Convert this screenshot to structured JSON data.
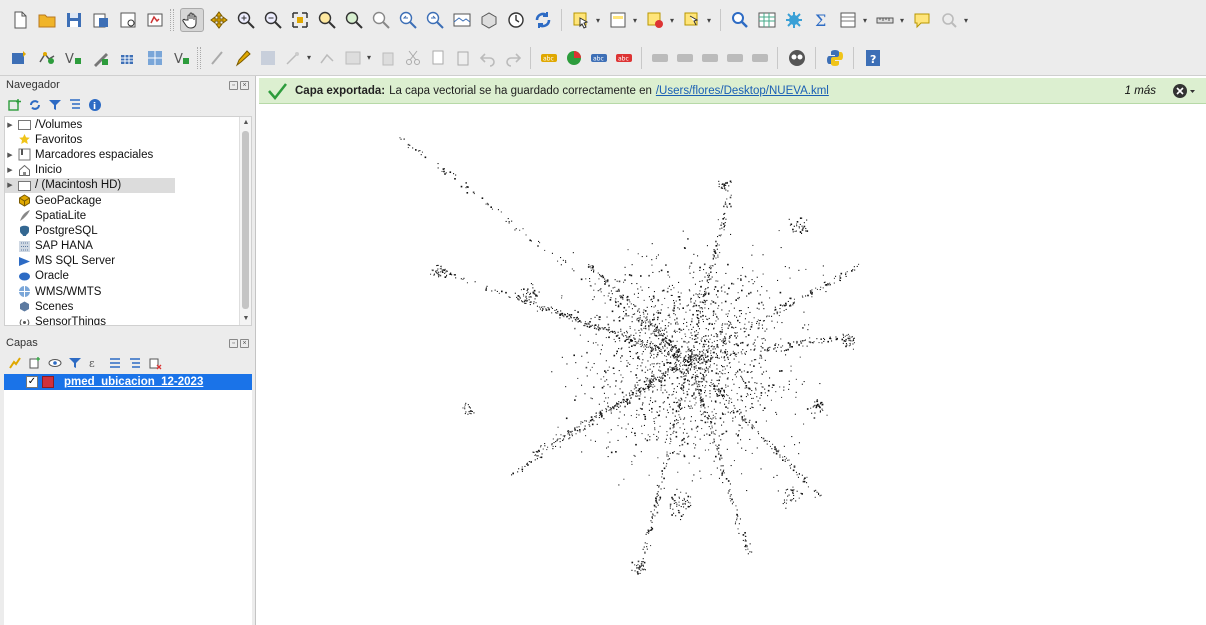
{
  "navigator": {
    "title": "Navegador",
    "items": [
      {
        "label": "/Volumes",
        "icon": "folder-icon",
        "expandable": true
      },
      {
        "label": "Favoritos",
        "icon": "star-icon",
        "expandable": false
      },
      {
        "label": "Marcadores espaciales",
        "icon": "bookmarks-icon",
        "expandable": true
      },
      {
        "label": "Inicio",
        "icon": "home-icon",
        "expandable": true
      },
      {
        "label": "/ (Macintosh HD)",
        "icon": "folder-icon",
        "expandable": true,
        "selected": true
      },
      {
        "label": "GeoPackage",
        "icon": "geopackage-icon",
        "expandable": false
      },
      {
        "label": "SpatiaLite",
        "icon": "spatialite-icon",
        "expandable": false
      },
      {
        "label": "PostgreSQL",
        "icon": "postgresql-icon",
        "expandable": false
      },
      {
        "label": "SAP HANA",
        "icon": "sap-hana-icon",
        "expandable": false
      },
      {
        "label": "MS SQL Server",
        "icon": "mssql-icon",
        "expandable": false
      },
      {
        "label": "Oracle",
        "icon": "oracle-icon",
        "expandable": false
      },
      {
        "label": "WMS/WMTS",
        "icon": "wms-icon",
        "expandable": false
      },
      {
        "label": "Scenes",
        "icon": "scenes-icon",
        "expandable": false
      },
      {
        "label": "SensorThings",
        "icon": "sensorthings-icon",
        "expandable": false
      }
    ]
  },
  "layers": {
    "title": "Capas",
    "items": [
      {
        "name": "pmed_ubicacion_12-2023",
        "checked": true,
        "symbol_color": "#d0313c"
      }
    ]
  },
  "message": {
    "title": "Capa exportada:",
    "text": "La capa vectorial se ha guardado correctamente en",
    "path": "/Users/flores/Desktop/NUEVA.kml",
    "more": "1 más"
  },
  "colors": {
    "message_bg": "#dcefd0",
    "selection": "#1a73e8",
    "link": "#1a5fb4"
  }
}
